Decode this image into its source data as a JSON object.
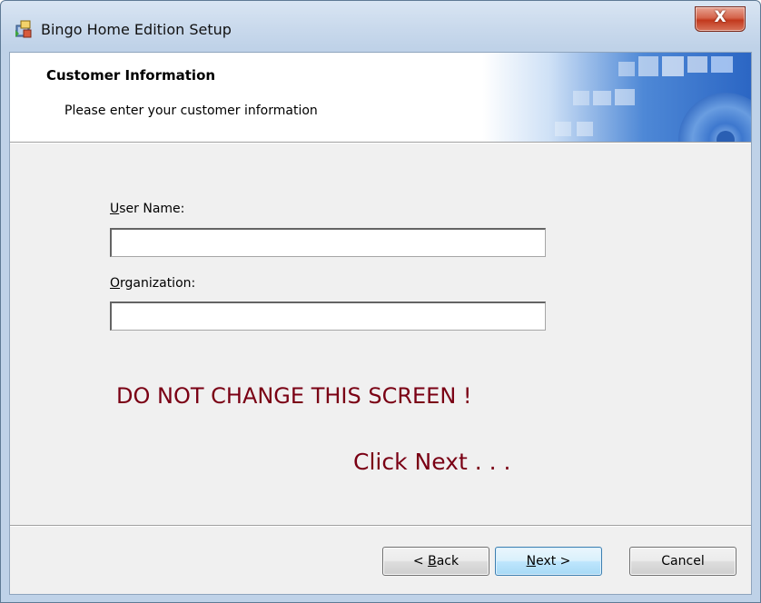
{
  "window": {
    "title": "Bingo Home Edition Setup",
    "close_glyph": "X"
  },
  "header": {
    "title": "Customer Information",
    "subtitle": "Please enter your customer information"
  },
  "form": {
    "user_name": {
      "label_mnemonic": "U",
      "label_rest": "ser Name:",
      "value": ""
    },
    "organization": {
      "label_mnemonic": "O",
      "label_rest": "rganization:",
      "value": ""
    }
  },
  "notice": {
    "line1": "DO NOT CHANGE THIS SCREEN !",
    "line2": "Click Next . . ."
  },
  "buttons": {
    "back": {
      "prefix": "< ",
      "mnemonic": "B",
      "rest": "ack"
    },
    "next": {
      "mnemonic": "N",
      "rest": "ext >"
    },
    "cancel": {
      "label": "Cancel"
    }
  },
  "colors": {
    "notice_text": "#7a0014",
    "default_button_border": "#3c7fb1",
    "close_button": "#c2391d"
  },
  "icons": {
    "app": "installer-package-icon",
    "close": "close-icon",
    "banner": "computer-disc-graphic"
  }
}
